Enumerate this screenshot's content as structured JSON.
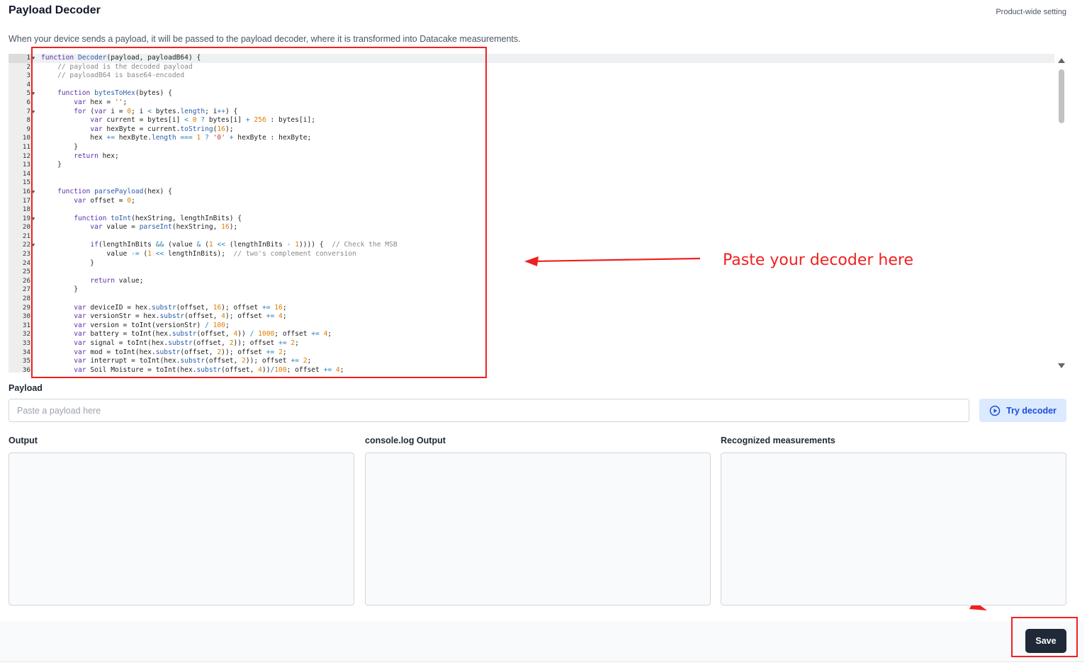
{
  "header": {
    "title": "Payload Decoder",
    "scope_note": "Product-wide setting",
    "description": "When your device sends a payload, it will be passed to the payload decoder, where it is transformed into Datacake measurements."
  },
  "editor": {
    "fold_lines": [
      1,
      5,
      7,
      16,
      19,
      22
    ],
    "lines": [
      "function Decoder(payload, payloadB64) {",
      "    // payload is the decoded payload",
      "    // payloadB64 is base64-encoded",
      "",
      "    function bytesToHex(bytes) {",
      "        var hex = '';",
      "        for (var i = 0; i < bytes.length; i++) {",
      "            var current = bytes[i] < 0 ? bytes[i] + 256 : bytes[i];",
      "            var hexByte = current.toString(16);",
      "            hex += hexByte.length === 1 ? '0' + hexByte : hexByte;",
      "        }",
      "        return hex;",
      "    }",
      "",
      "",
      "    function parsePayload(hex) {",
      "        var offset = 0;",
      "",
      "        function toInt(hexString, lengthInBits) {",
      "            var value = parseInt(hexString, 16);",
      "",
      "            if(lengthInBits && (value & (1 << (lengthInBits - 1)))) {  // Check the MSB",
      "                value -= (1 << lengthInBits);  // two's complement conversion",
      "            }",
      "",
      "            return value;",
      "        }",
      "",
      "        var deviceID = hex.substr(offset, 16); offset += 16;",
      "        var versionStr = hex.substr(offset, 4); offset += 4;",
      "        var version = toInt(versionStr) / 100;",
      "        var battery = toInt(hex.substr(offset, 4)) / 1000; offset += 4;",
      "        var signal = toInt(hex.substr(offset, 2)); offset += 2;",
      "        var mod = toInt(hex.substr(offset, 2)); offset += 2;",
      "        var interrupt = toInt(hex.substr(offset, 2)); offset += 2;",
      "        var Soil_Moisture = toInt(hex.substr(offset, 4))/100; offset += 4;"
    ]
  },
  "annotation": {
    "callout": "Paste your decoder here",
    "color": "#f02020"
  },
  "payload": {
    "label": "Payload",
    "placeholder": "Paste a payload here",
    "try_label": "Try decoder"
  },
  "panels": {
    "output_label": "Output",
    "console_label": "console.log Output",
    "measurements_label": "Recognized measurements"
  },
  "footer": {
    "save_label": "Save"
  }
}
